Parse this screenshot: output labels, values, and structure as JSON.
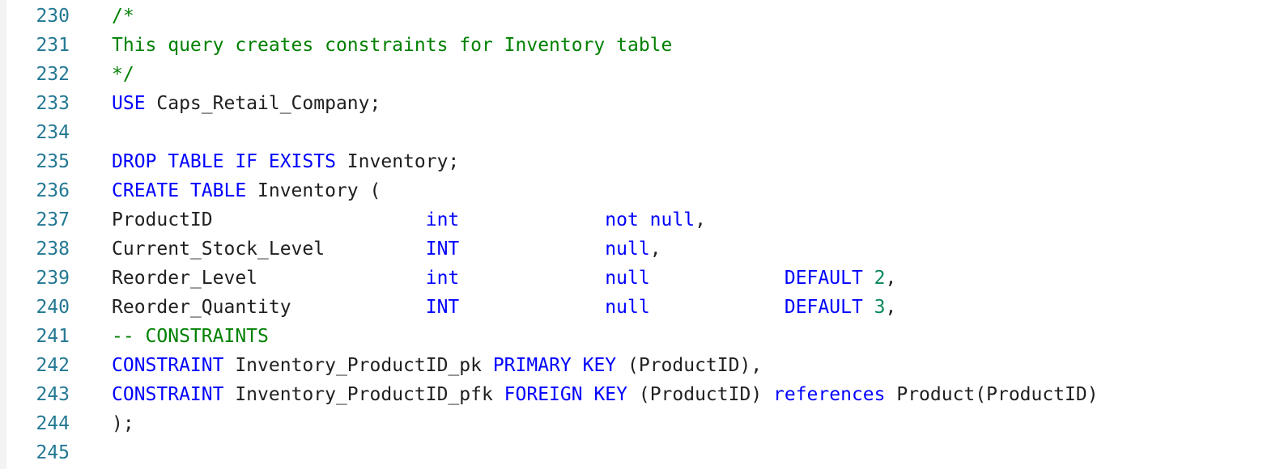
{
  "editor": {
    "language": "sql",
    "colors": {
      "keyword": "#0000ff",
      "comment": "#008000",
      "number": "#098658",
      "text": "#1f1f1f",
      "line_number": "#237893",
      "background": "#ffffff"
    },
    "lines": [
      {
        "number": "230",
        "tokens": [
          {
            "type": "cm",
            "text": "/*"
          }
        ]
      },
      {
        "number": "231",
        "tokens": [
          {
            "type": "cm",
            "text": "This query creates constraints for Inventory table"
          }
        ]
      },
      {
        "number": "232",
        "tokens": [
          {
            "type": "cm",
            "text": "*/"
          }
        ]
      },
      {
        "number": "233",
        "tokens": [
          {
            "type": "kw",
            "text": "USE"
          },
          {
            "type": "tx",
            "text": " Caps_Retail_Company;"
          }
        ]
      },
      {
        "number": "234",
        "tokens": []
      },
      {
        "number": "235",
        "tokens": [
          {
            "type": "kw",
            "text": "DROP TABLE IF EXISTS"
          },
          {
            "type": "tx",
            "text": " Inventory;"
          }
        ]
      },
      {
        "number": "236",
        "tokens": [
          {
            "type": "kw",
            "text": "CREATE TABLE"
          },
          {
            "type": "tx",
            "text": " Inventory ("
          }
        ]
      },
      {
        "number": "237",
        "tokens": [
          {
            "type": "tx",
            "text": "ProductID                   "
          },
          {
            "type": "kw",
            "text": "int"
          },
          {
            "type": "tx",
            "text": "             "
          },
          {
            "type": "kw",
            "text": "not null"
          },
          {
            "type": "tx",
            "text": ","
          }
        ]
      },
      {
        "number": "238",
        "tokens": [
          {
            "type": "tx",
            "text": "Current_Stock_Level         "
          },
          {
            "type": "kw",
            "text": "INT"
          },
          {
            "type": "tx",
            "text": "             "
          },
          {
            "type": "kw",
            "text": "null"
          },
          {
            "type": "tx",
            "text": ","
          }
        ]
      },
      {
        "number": "239",
        "tokens": [
          {
            "type": "tx",
            "text": "Reorder_Level               "
          },
          {
            "type": "kw",
            "text": "int"
          },
          {
            "type": "tx",
            "text": "             "
          },
          {
            "type": "kw",
            "text": "null"
          },
          {
            "type": "tx",
            "text": "            "
          },
          {
            "type": "kw",
            "text": "DEFAULT"
          },
          {
            "type": "tx",
            "text": " "
          },
          {
            "type": "nm",
            "text": "2"
          },
          {
            "type": "tx",
            "text": ","
          }
        ]
      },
      {
        "number": "240",
        "tokens": [
          {
            "type": "tx",
            "text": "Reorder_Quantity            "
          },
          {
            "type": "kw",
            "text": "INT"
          },
          {
            "type": "tx",
            "text": "             "
          },
          {
            "type": "kw",
            "text": "null"
          },
          {
            "type": "tx",
            "text": "            "
          },
          {
            "type": "kw",
            "text": "DEFAULT"
          },
          {
            "type": "tx",
            "text": " "
          },
          {
            "type": "nm",
            "text": "3"
          },
          {
            "type": "tx",
            "text": ","
          }
        ]
      },
      {
        "number": "241",
        "tokens": [
          {
            "type": "cm",
            "text": "-- CONSTRAINTS"
          }
        ]
      },
      {
        "number": "242",
        "tokens": [
          {
            "type": "kw",
            "text": "CONSTRAINT"
          },
          {
            "type": "tx",
            "text": " Inventory_ProductID_pk "
          },
          {
            "type": "kw",
            "text": "PRIMARY KEY"
          },
          {
            "type": "tx",
            "text": " (ProductID),"
          }
        ]
      },
      {
        "number": "243",
        "tokens": [
          {
            "type": "kw",
            "text": "CONSTRAINT"
          },
          {
            "type": "tx",
            "text": " Inventory_ProductID_pfk "
          },
          {
            "type": "kw",
            "text": "FOREIGN KEY"
          },
          {
            "type": "tx",
            "text": " (ProductID) "
          },
          {
            "type": "kw",
            "text": "references"
          },
          {
            "type": "tx",
            "text": " Product(ProductID)"
          }
        ]
      },
      {
        "number": "244",
        "tokens": [
          {
            "type": "tx",
            "text": ");"
          }
        ]
      },
      {
        "number": "245",
        "tokens": []
      }
    ]
  }
}
